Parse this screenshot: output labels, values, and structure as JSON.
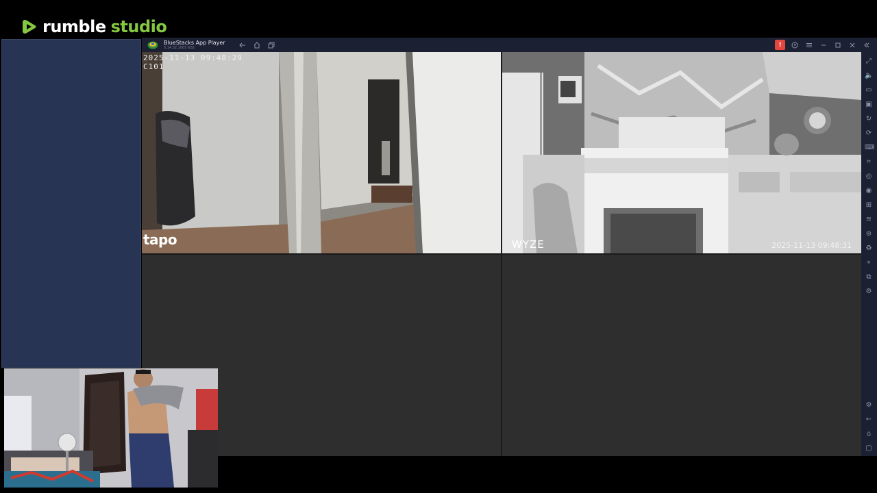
{
  "brand": {
    "rumble": "rumble",
    "studio": "studio",
    "accent": "#85c742"
  },
  "bluestacks": {
    "title": "BlueStacks App Player",
    "version": "5.14.32.1005 N32",
    "nav_icons": [
      "back-icon",
      "home-icon",
      "multi-instance-icon"
    ],
    "window_controls": [
      "notification-icon",
      "help-icon",
      "menu-icon",
      "minimize-icon",
      "maximize-icon",
      "close-icon",
      "collapse-sidebar-icon"
    ],
    "notification_count": "!",
    "sidebar_icons": [
      "fullscreen-icon",
      "volume-icon",
      "screen-record-icon",
      "media-manager-icon",
      "rotate-icon",
      "sync-icon",
      "gamepad-icon",
      "keymapping-icon",
      "screenshot-icon",
      "record-icon",
      "install-apk-icon",
      "shake-icon",
      "macro-icon",
      "eco-mode-icon",
      "location-icon",
      "multi-instance-sync-icon",
      "performance-icon",
      "settings-icon",
      "back-icon",
      "home-icon",
      "recent-apps-icon"
    ]
  },
  "cameras": {
    "tapo": {
      "brand": "tapo",
      "timestamp": "2025-11-13 09:48:29",
      "camera_id": "C101"
    },
    "wyze": {
      "brand": "WYZE",
      "timestamp": "2025-11-13 09:48:31"
    }
  }
}
